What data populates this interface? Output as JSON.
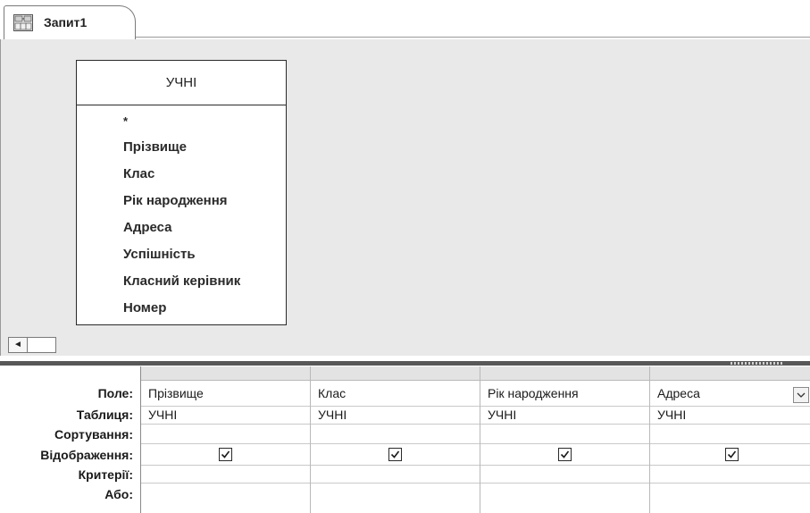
{
  "tab": {
    "title": "Запит1",
    "icon": "query-icon"
  },
  "table_window": {
    "title": "УЧНІ",
    "fields": [
      "*",
      "Прізвище",
      "Клас",
      "Рік народження",
      "Адреса",
      "Успішність",
      "Класний керівник",
      "Номер"
    ]
  },
  "scrollbar": {
    "left_arrow": "◄"
  },
  "grid": {
    "row_labels": {
      "field": "Поле:",
      "table": "Таблиця:",
      "sort": "Сортування:",
      "show": "Відображення:",
      "criteria": "Критерії:",
      "or": "Або:"
    },
    "columns": [
      {
        "field": "Прізвище",
        "table": "УЧНІ",
        "sort": "",
        "show": true,
        "criteria": "",
        "or": ""
      },
      {
        "field": "Клас",
        "table": "УЧНІ",
        "sort": "",
        "show": true,
        "criteria": "",
        "or": ""
      },
      {
        "field": "Рік народження",
        "table": "УЧНІ",
        "sort": "",
        "show": true,
        "criteria": "",
        "or": ""
      },
      {
        "field": "Адреса",
        "table": "УЧНІ",
        "sort": "",
        "show": true,
        "criteria": "",
        "or": "",
        "dropdown_open": true
      }
    ]
  }
}
